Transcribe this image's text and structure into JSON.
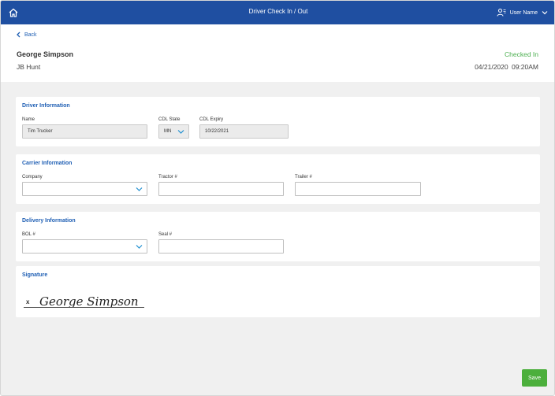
{
  "topbar": {
    "title": "Driver Check In / Out",
    "user_label": "User Name",
    "icons": {
      "home": "home-icon",
      "user": "user-settings-icon",
      "dropdown": "chevron-down-icon"
    }
  },
  "header": {
    "back_label": "Back",
    "driver_name": "George Simpson",
    "carrier": "JB Hunt",
    "status": "Checked In",
    "datetime": "04/21/2020  09:20AM"
  },
  "driver_info": {
    "title": "Driver Information",
    "name_label": "Name",
    "name_value": "Tim Trucker",
    "cdl_state_label": "CDL State",
    "cdl_state_value": "MN",
    "cdl_expiry_label": "CDL Expiry",
    "cdl_expiry_value": "10/22/2021"
  },
  "carrier_info": {
    "title": "Carrier Information",
    "company_label": "Company",
    "company_value": "",
    "tractor_label": "Tractor #",
    "tractor_value": "",
    "trailer_label": "Trailer #",
    "trailer_value": ""
  },
  "delivery_info": {
    "title": "Delivery Information",
    "bol_label": "BOL #",
    "bol_value": "",
    "seal_label": "Seal #",
    "seal_value": ""
  },
  "signature": {
    "title": "Signature",
    "x_mark": "x",
    "signed_name": "George Simpson"
  },
  "actions": {
    "save_label": "Save"
  },
  "colors": {
    "topbar": "#1f4fa1",
    "accent_text": "#1f5fb4",
    "status_green": "#4caf50",
    "save_green": "#4caf3c"
  }
}
